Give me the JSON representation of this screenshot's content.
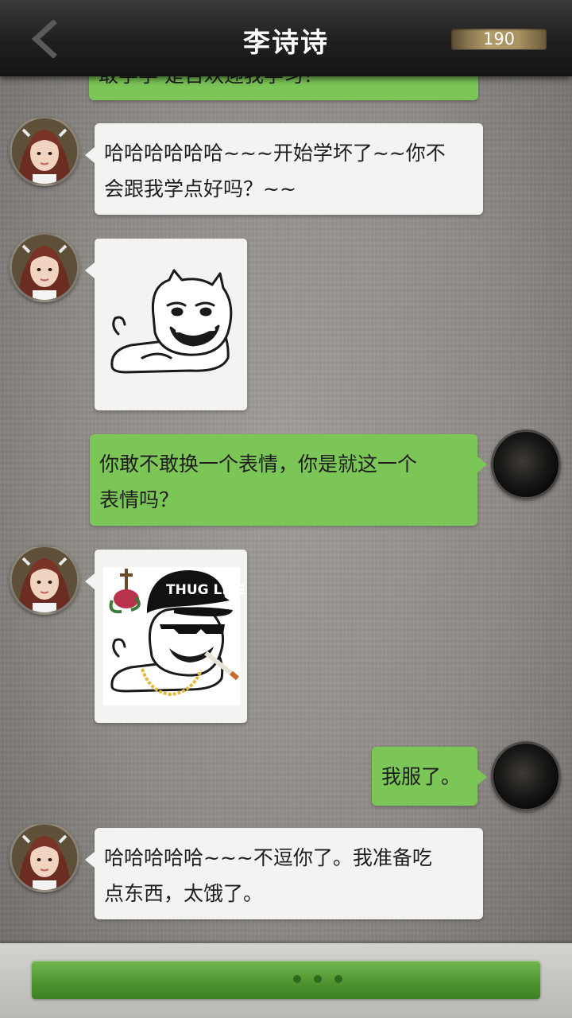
{
  "header": {
    "title": "李诗诗",
    "counter": "190",
    "back_icon": "chevron-left-icon"
  },
  "messages": [
    {
      "side": "out",
      "type": "text",
      "text": "敢学学 是否欢迎我学习？"
    },
    {
      "side": "in",
      "type": "text",
      "text": "哈哈哈哈哈哈~~~开始学坏了~~你不\n会跟我学点好吗？~~"
    },
    {
      "side": "in",
      "type": "sticker",
      "sticker": "smug-meme-face-sticker"
    },
    {
      "side": "out",
      "type": "text",
      "text": "你敢不敢换一个表情，你是就这一个\n表情吗？"
    },
    {
      "side": "in",
      "type": "sticker",
      "sticker": "thug-life-meme-sticker",
      "sticker_text": "THUG LIFE"
    },
    {
      "side": "out",
      "type": "text",
      "text": "我服了。"
    },
    {
      "side": "in",
      "type": "text",
      "text": "哈哈哈哈哈~~~不逗你了。我准备吃\n点东西，太饿了。"
    }
  ],
  "bottom_bar": {
    "indicator_icon": "typing-dots-icon"
  },
  "colors": {
    "incoming_bubble": "#f3f3f1",
    "outgoing_bubble": "#7cc557",
    "header": "#1f1f1f",
    "input_button": "#4f9330"
  }
}
